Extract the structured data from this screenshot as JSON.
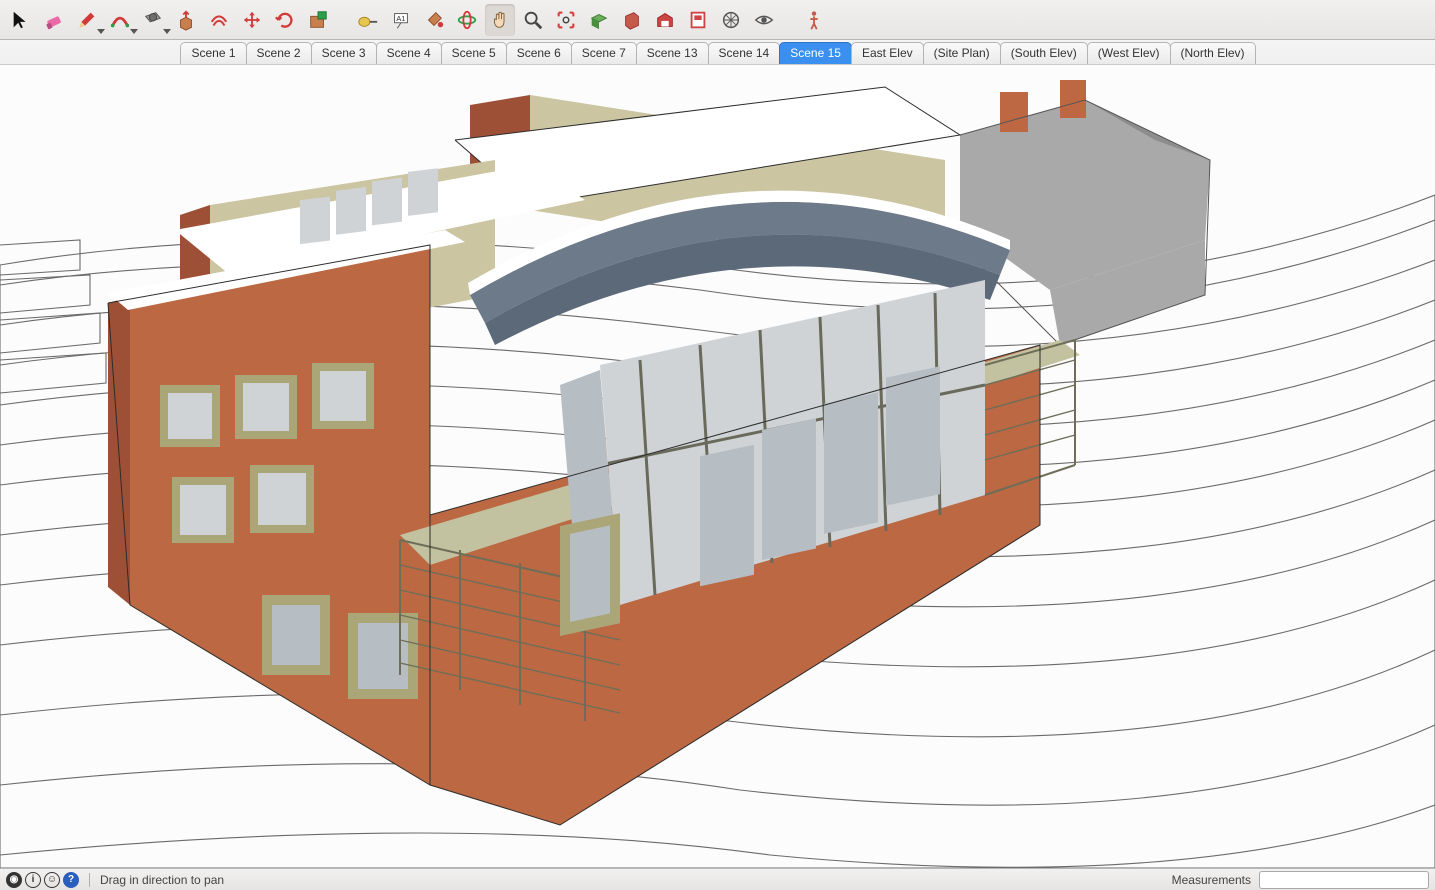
{
  "toolbar": {
    "tools": [
      {
        "name": "select-cursor-icon",
        "dd": false
      },
      {
        "name": "eraser-icon",
        "dd": false
      },
      {
        "name": "pencil-icon",
        "dd": true
      },
      {
        "name": "arc-icon",
        "dd": true
      },
      {
        "name": "shape-rectangle-icon",
        "dd": true
      },
      {
        "name": "push-pull-icon",
        "dd": false
      },
      {
        "name": "offset-icon",
        "dd": false
      },
      {
        "name": "move-icon",
        "dd": false
      },
      {
        "name": "rotate-icon",
        "dd": false
      },
      {
        "name": "scale-icon",
        "dd": false
      },
      {
        "name": "tape-measure-icon",
        "dd": false
      },
      {
        "name": "text-label-icon",
        "dd": false
      },
      {
        "name": "paint-bucket-icon",
        "dd": false
      },
      {
        "name": "orbit-icon",
        "dd": false
      },
      {
        "name": "pan-hand-icon",
        "dd": false,
        "active": true
      },
      {
        "name": "zoom-icon",
        "dd": false
      },
      {
        "name": "zoom-extents-icon",
        "dd": false
      },
      {
        "name": "section-plane-icon",
        "dd": false
      },
      {
        "name": "add-location-icon",
        "dd": false
      },
      {
        "name": "3d-warehouse-icon",
        "dd": false
      },
      {
        "name": "layout-icon",
        "dd": false
      },
      {
        "name": "style-builder-icon",
        "dd": false
      },
      {
        "name": "eye-icon",
        "dd": false
      },
      {
        "name": "human-figure-icon",
        "dd": false
      }
    ]
  },
  "scenes": [
    {
      "label": "Scene 1",
      "active": false
    },
    {
      "label": "Scene 2",
      "active": false
    },
    {
      "label": "Scene 3",
      "active": false
    },
    {
      "label": "Scene 4",
      "active": false
    },
    {
      "label": "Scene 5",
      "active": false
    },
    {
      "label": "Scene 6",
      "active": false
    },
    {
      "label": "Scene 7",
      "active": false
    },
    {
      "label": "Scene 13",
      "active": false
    },
    {
      "label": "Scene 14",
      "active": false
    },
    {
      "label": "Scene 15",
      "active": true
    },
    {
      "label": "East Elev",
      "active": false
    },
    {
      "label": "(Site Plan)",
      "active": false
    },
    {
      "label": "(South Elev)",
      "active": false
    },
    {
      "label": "(West Elev)",
      "active": false
    },
    {
      "label": "(North Elev)",
      "active": false
    }
  ],
  "statusbar": {
    "hint": "Drag in direction to pan",
    "measurements_label": "Measurements",
    "measurements_value": ""
  },
  "colors": {
    "accent": "#3b8fee",
    "brick": "#bb6843",
    "cream": "#cbc5a1",
    "roof": "#6c7a8a"
  }
}
